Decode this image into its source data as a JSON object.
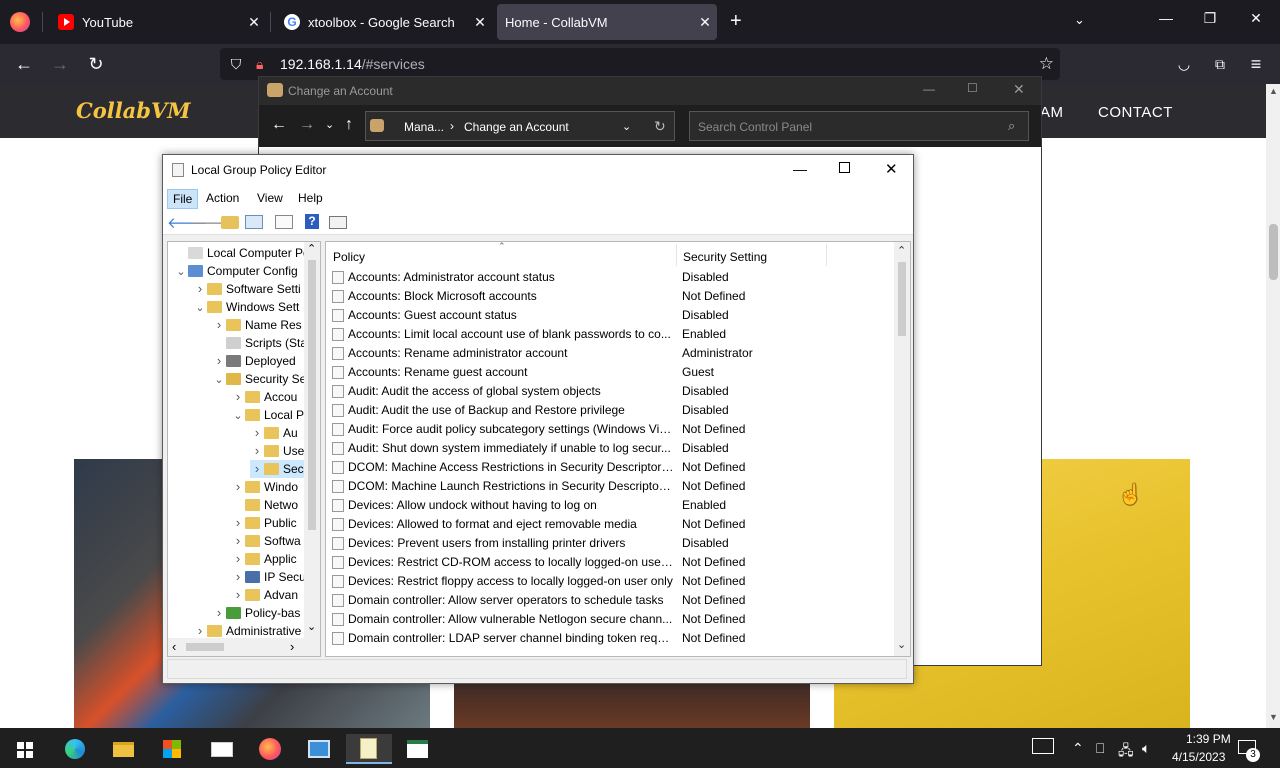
{
  "browser": {
    "tabs": [
      {
        "title": "YouTube"
      },
      {
        "title": "xtoolbox - Google Search"
      },
      {
        "title": "Home - CollabVM"
      }
    ],
    "url_host": "192.168.1.14",
    "url_path": "/#services"
  },
  "site": {
    "logo": "CollabVM",
    "nav": [
      "AM",
      "CONTACT"
    ]
  },
  "control_panel": {
    "title": "Change an Account",
    "breadcrumb": [
      "Mana...",
      "Change an Account"
    ],
    "search_placeholder": "Search Control Panel"
  },
  "gpe": {
    "title": "Local Group Policy Editor",
    "menu": [
      "File",
      "Action",
      "View",
      "Help"
    ],
    "tree": [
      {
        "label": "Local Computer Polic",
        "depth": 0,
        "arrow": "",
        "icon": "computer-policy-icon"
      },
      {
        "label": "Computer Config",
        "depth": 0,
        "arrow": "v",
        "icon": "computer-icon"
      },
      {
        "label": "Software Setti",
        "depth": 1,
        "arrow": ">",
        "icon": "folder-icon"
      },
      {
        "label": "Windows Sett",
        "depth": 1,
        "arrow": "v",
        "icon": "folder-icon"
      },
      {
        "label": "Name Res",
        "depth": 2,
        "arrow": ">",
        "icon": "folder-icon"
      },
      {
        "label": "Scripts (Sta",
        "depth": 2,
        "arrow": "",
        "icon": "script-icon"
      },
      {
        "label": "Deployed",
        "depth": 2,
        "arrow": ">",
        "icon": "printer-icon"
      },
      {
        "label": "Security Se",
        "depth": 2,
        "arrow": "v",
        "icon": "security-icon"
      },
      {
        "label": "Accou",
        "depth": 3,
        "arrow": ">",
        "icon": "security-folder-icon"
      },
      {
        "label": "Local P",
        "depth": 3,
        "arrow": "v",
        "icon": "security-folder-icon"
      },
      {
        "label": "Au",
        "depth": 4,
        "arrow": ">",
        "icon": "security-folder-icon"
      },
      {
        "label": "Use",
        "depth": 4,
        "arrow": ">",
        "icon": "security-folder-icon"
      },
      {
        "label": "Sec",
        "depth": 4,
        "arrow": ">",
        "icon": "security-folder-icon",
        "selected": true
      },
      {
        "label": "Windo",
        "depth": 3,
        "arrow": ">",
        "icon": "folder-icon"
      },
      {
        "label": "Netwo",
        "depth": 3,
        "arrow": "",
        "icon": "folder-icon"
      },
      {
        "label": "Public",
        "depth": 3,
        "arrow": ">",
        "icon": "folder-icon"
      },
      {
        "label": "Softwa",
        "depth": 3,
        "arrow": ">",
        "icon": "folder-icon"
      },
      {
        "label": "Applic",
        "depth": 3,
        "arrow": ">",
        "icon": "folder-icon"
      },
      {
        "label": "IP Secu",
        "depth": 3,
        "arrow": ">",
        "icon": "ipsec-icon"
      },
      {
        "label": "Advan",
        "depth": 3,
        "arrow": ">",
        "icon": "folder-icon"
      },
      {
        "label": "Policy-bas",
        "depth": 2,
        "arrow": ">",
        "icon": "chart-icon"
      },
      {
        "label": "Administrative",
        "depth": 1,
        "arrow": ">",
        "icon": "folder-icon"
      }
    ],
    "columns": [
      "Policy",
      "Security Setting"
    ],
    "policies": [
      [
        "Accounts: Administrator account status",
        "Disabled"
      ],
      [
        "Accounts: Block Microsoft accounts",
        "Not Defined"
      ],
      [
        "Accounts: Guest account status",
        "Disabled"
      ],
      [
        "Accounts: Limit local account use of blank passwords to co...",
        "Enabled"
      ],
      [
        "Accounts: Rename administrator account",
        "Administrator"
      ],
      [
        "Accounts: Rename guest account",
        "Guest"
      ],
      [
        "Audit: Audit the access of global system objects",
        "Disabled"
      ],
      [
        "Audit: Audit the use of Backup and Restore privilege",
        "Disabled"
      ],
      [
        "Audit: Force audit policy subcategory settings (Windows Vis...",
        "Not Defined"
      ],
      [
        "Audit: Shut down system immediately if unable to log secur...",
        "Disabled"
      ],
      [
        "DCOM: Machine Access Restrictions in Security Descriptor D...",
        "Not Defined"
      ],
      [
        "DCOM: Machine Launch Restrictions in Security Descriptor ...",
        "Not Defined"
      ],
      [
        "Devices: Allow undock without having to log on",
        "Enabled"
      ],
      [
        "Devices: Allowed to format and eject removable media",
        "Not Defined"
      ],
      [
        "Devices: Prevent users from installing printer drivers",
        "Disabled"
      ],
      [
        "Devices: Restrict CD-ROM access to locally logged-on user ...",
        "Not Defined"
      ],
      [
        "Devices: Restrict floppy access to locally logged-on user only",
        "Not Defined"
      ],
      [
        "Domain controller: Allow server operators to schedule tasks",
        "Not Defined"
      ],
      [
        "Domain controller: Allow vulnerable Netlogon secure chann...",
        "Not Defined"
      ],
      [
        "Domain controller: LDAP server channel binding token requi...",
        "Not Defined"
      ]
    ]
  },
  "taskbar": {
    "time": "1:39 PM",
    "date": "4/15/2023",
    "notifications": "3"
  }
}
